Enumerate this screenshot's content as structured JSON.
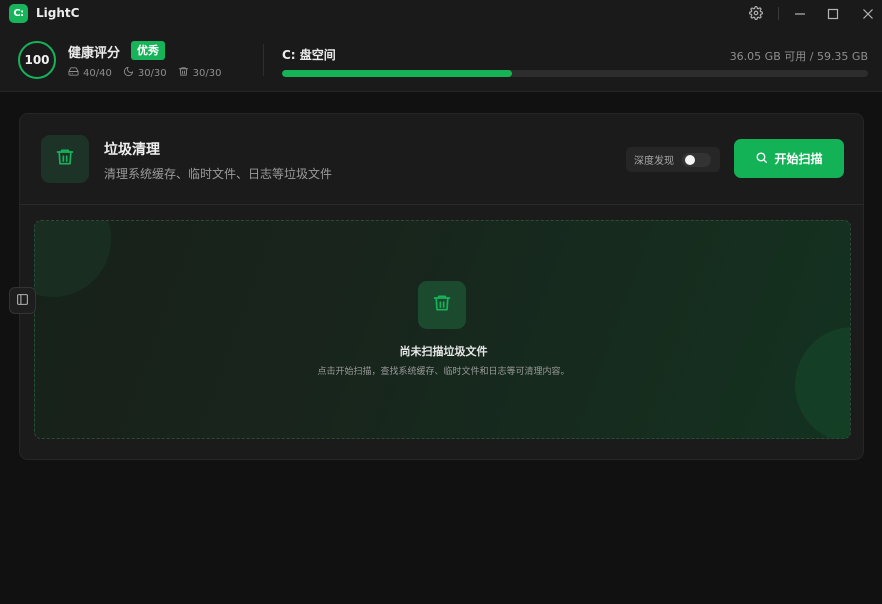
{
  "titlebar": {
    "logo_text": "C:",
    "title": "LightC",
    "icons": [
      "gear-icon",
      "minimize-icon",
      "maximize-icon",
      "close-icon"
    ]
  },
  "header": {
    "score": "100",
    "health_label": "健康评分",
    "health_badge": "优秀",
    "stats": [
      {
        "icon": "drive-icon",
        "value": "40/40"
      },
      {
        "icon": "moon-icon",
        "value": "30/30"
      },
      {
        "icon": "trash-icon",
        "value": "30/30"
      }
    ],
    "disk": {
      "title": "C: 盘空间",
      "info": "36.05 GB 可用 / 59.35 GB",
      "used_fraction": 0.393
    }
  },
  "card": {
    "title": "垃圾清理",
    "subtitle": "清理系统缓存、临时文件、日志等垃圾文件",
    "deep_scan_label": "深度发现",
    "deep_scan_on": false,
    "scan_button": "开始扫描",
    "empty_title": "尚未扫描垃圾文件",
    "empty_desc": "点击开始扫描，查找系统缓存、临时文件和日志等可清理内容。"
  },
  "colors": {
    "accent": "#17b358",
    "background": "#111111",
    "panel": "#1b1b1b"
  }
}
